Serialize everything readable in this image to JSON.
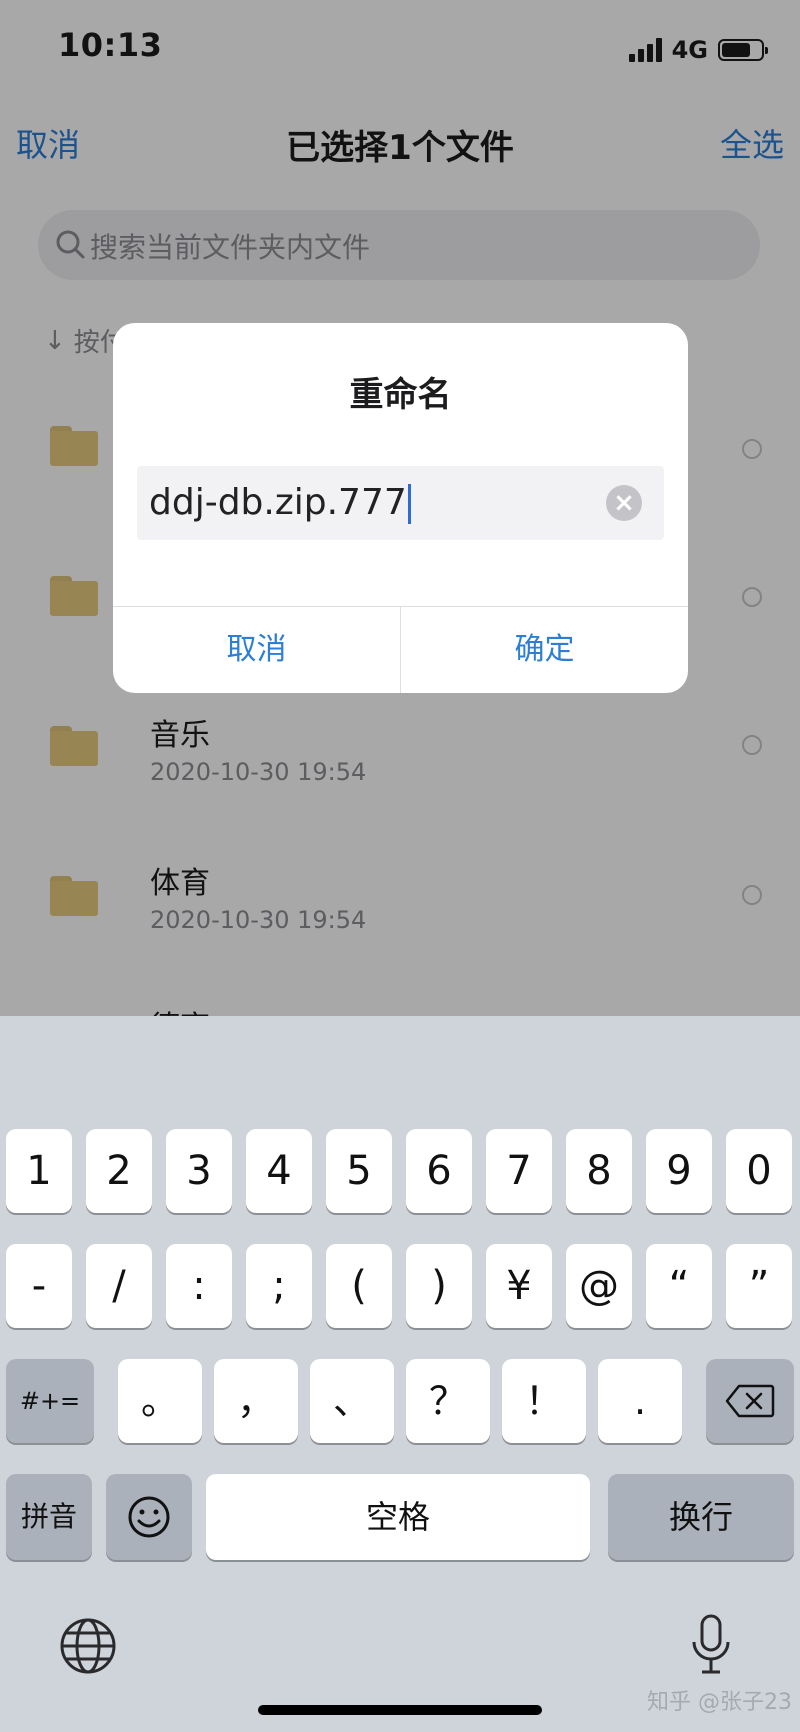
{
  "status_bar": {
    "time": "10:13",
    "network": "4G"
  },
  "nav": {
    "cancel": "取消",
    "title": "已选择1个文件",
    "select_all": "全选"
  },
  "search": {
    "placeholder": "搜索当前文件夹内文件"
  },
  "sort": {
    "label": "按付"
  },
  "files": [
    {
      "name": "音乐",
      "date": "2020-10-30 19:54"
    },
    {
      "name": "体育",
      "date": "2020-10-30 19:54"
    },
    {
      "name": "德育"
    }
  ],
  "dialog": {
    "title": "重命名",
    "input_value": "ddj-db.zip.777",
    "cancel": "取消",
    "confirm": "确定"
  },
  "keyboard": {
    "row1": [
      "1",
      "2",
      "3",
      "4",
      "5",
      "6",
      "7",
      "8",
      "9",
      "0"
    ],
    "row2": [
      "-",
      "/",
      ":",
      ";",
      "(",
      ")",
      "¥",
      "@",
      "“",
      "”"
    ],
    "row3_left": "#+=",
    "row3": [
      "。",
      "，",
      "、",
      "？",
      "！",
      "."
    ],
    "pinyin": "拼音",
    "space": "空格",
    "return": "换行"
  },
  "watermark": "知乎 @张子23",
  "colors": {
    "accent": "#2d7fd6",
    "folder": "#e6cc7e",
    "keyboard_bg": "#cfd3da"
  }
}
